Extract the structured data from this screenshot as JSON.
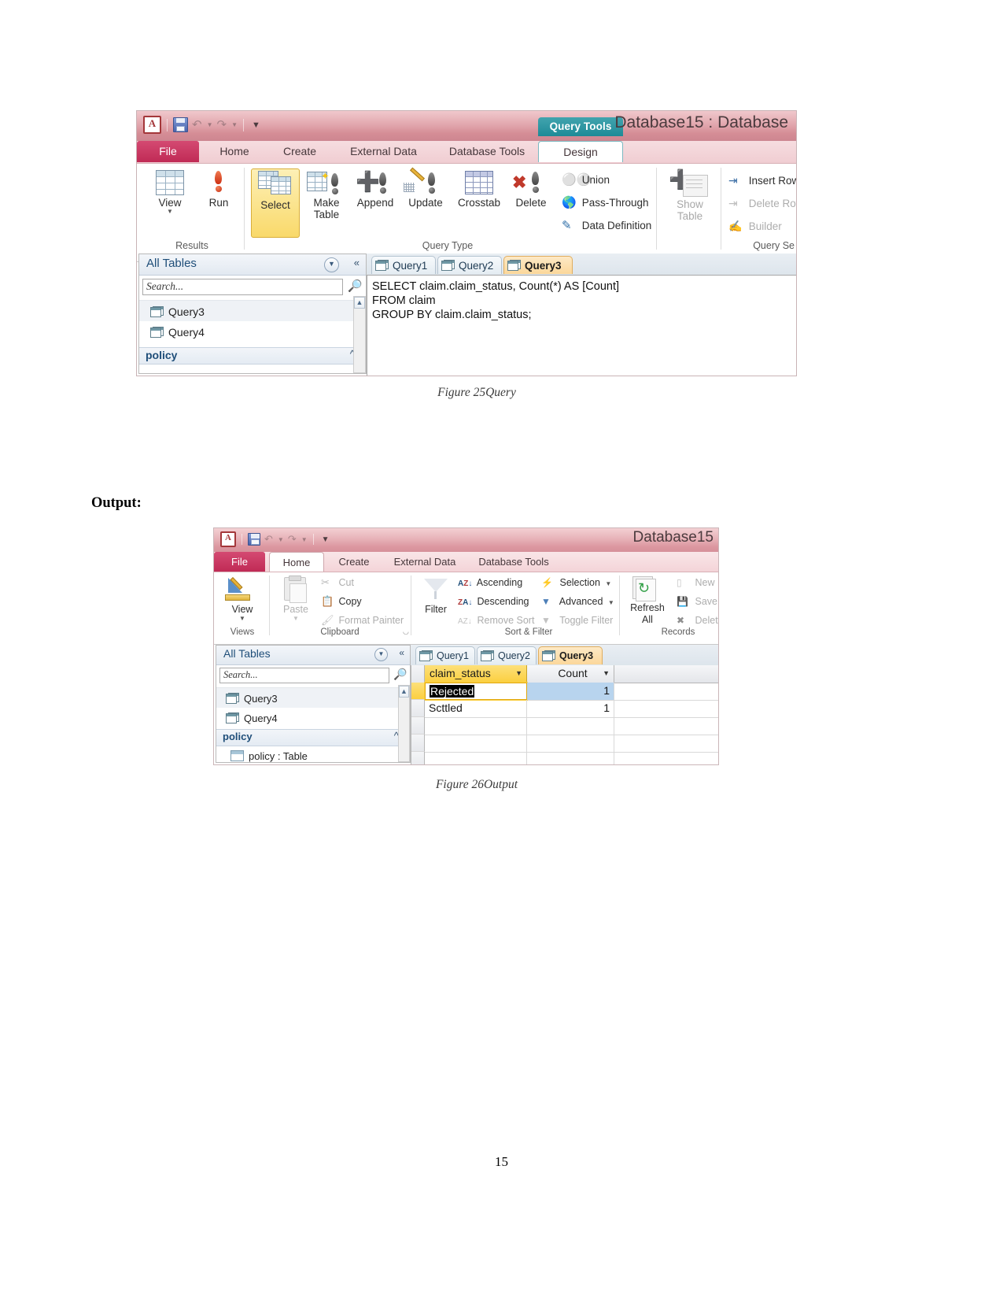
{
  "page": {
    "page_number": "15",
    "output_heading": "Output:"
  },
  "figure25": {
    "caption": "Figure 25Query",
    "window": {
      "title": "Database15 : Database",
      "quick_access": {
        "app_logo": "A",
        "save": "save-icon",
        "undo": "undo-icon",
        "redo": "redo-icon",
        "customize": "customize-qat-icon"
      },
      "contextual_tab_group": "Query Tools",
      "tabs": [
        {
          "label": "File",
          "state": "file"
        },
        {
          "label": "Home",
          "state": "normal"
        },
        {
          "label": "Create",
          "state": "normal"
        },
        {
          "label": "External Data",
          "state": "normal"
        },
        {
          "label": "Database Tools",
          "state": "normal"
        },
        {
          "label": "Design",
          "state": "active"
        }
      ],
      "ribbon": {
        "groups": [
          {
            "label": "Results"
          },
          {
            "label": "Query Type"
          },
          {
            "label": "Query Se"
          }
        ],
        "results_buttons": [
          {
            "label": "View",
            "icon": "view-grid-icon",
            "has_dropdown": true
          },
          {
            "label": "Run",
            "icon": "run-exclamation-icon"
          }
        ],
        "query_type_buttons": [
          {
            "label": "Select",
            "icon": "select-query-icon",
            "selected": true
          },
          {
            "label": "Make\nTable",
            "line1": "Make",
            "line2": "Table",
            "icon": "make-table-icon"
          },
          {
            "label": "Append",
            "icon": "append-query-icon"
          },
          {
            "label": "Update",
            "icon": "update-query-icon"
          },
          {
            "label": "Crosstab",
            "icon": "crosstab-query-icon"
          },
          {
            "label": "Delete",
            "icon": "delete-query-icon"
          }
        ],
        "query_type_small": [
          {
            "label": "Union",
            "icon": "union-icon"
          },
          {
            "label": "Pass-Through",
            "icon": "pass-through-icon"
          },
          {
            "label": "Data Definition",
            "icon": "data-definition-icon"
          }
        ],
        "setup_buttons": [
          {
            "label": "Show\nTable",
            "line1": "Show",
            "line2": "Table",
            "icon": "show-table-icon",
            "disabled": true
          }
        ],
        "setup_small": [
          {
            "label": "Insert Rows",
            "icon": "insert-rows-icon",
            "disabled": false
          },
          {
            "label": "Delete Rows",
            "icon": "delete-rows-icon",
            "disabled": true
          },
          {
            "label": "Builder",
            "icon": "builder-icon",
            "disabled": true
          }
        ]
      },
      "nav_pane": {
        "title": "All Tables",
        "menu_icon": "chevron-down-circle-icon",
        "collapse_icon": "double-chevron-left-icon",
        "search_placeholder": "Search...",
        "search_value": "",
        "search_icon": "search-icon",
        "items": [
          {
            "label": "Query3",
            "icon": "query-icon",
            "selected": true
          },
          {
            "label": "Query4",
            "icon": "query-icon",
            "selected": false
          }
        ],
        "groups": [
          {
            "label": "policy",
            "collapse_icon": "double-chevron-up-icon"
          }
        ]
      },
      "doc_tabs": [
        {
          "label": "Query1",
          "icon": "query-icon",
          "selected": false
        },
        {
          "label": "Query2",
          "icon": "query-icon",
          "selected": false
        },
        {
          "label": "Query3",
          "icon": "query-icon",
          "selected": true
        }
      ],
      "sql": "SELECT claim.claim_status, Count(*) AS [Count]\nFROM claim\nGROUP BY claim.claim_status;"
    }
  },
  "figure26": {
    "caption": "Figure 26Output",
    "window": {
      "title": "Database15",
      "quick_access": {
        "app_logo": "A",
        "save": "save-icon",
        "undo": "undo-icon",
        "redo": "redo-icon",
        "customize": "customize-qat-icon"
      },
      "tabs": [
        {
          "label": "File",
          "state": "file"
        },
        {
          "label": "Home",
          "state": "active"
        },
        {
          "label": "Create",
          "state": "normal"
        },
        {
          "label": "External Data",
          "state": "normal"
        },
        {
          "label": "Database Tools",
          "state": "normal"
        }
      ],
      "ribbon": {
        "groups": [
          {
            "label": "Views"
          },
          {
            "label": "Clipboard"
          },
          {
            "label": "Sort & Filter"
          },
          {
            "label": "Records"
          }
        ],
        "views_buttons": [
          {
            "label": "View",
            "icon": "view-design-icon",
            "has_dropdown": true
          }
        ],
        "clipboard_buttons": [
          {
            "label": "Paste",
            "icon": "paste-icon",
            "disabled": true,
            "has_dropdown": true
          }
        ],
        "clipboard_small": [
          {
            "label": "Cut",
            "icon": "cut-scissors-icon",
            "disabled": true
          },
          {
            "label": "Copy",
            "icon": "copy-icon",
            "disabled": false
          },
          {
            "label": "Format Painter",
            "icon": "format-painter-icon",
            "disabled": true
          }
        ],
        "clipboard_launcher": "dialog-launcher-icon",
        "sort_filter_buttons": [
          {
            "label": "Filter",
            "icon": "filter-funnel-icon"
          }
        ],
        "sort_filter_small": [
          {
            "label": "Ascending",
            "icon": "sort-ascending-icon",
            "disabled": false
          },
          {
            "label": "Descending",
            "icon": "sort-descending-icon",
            "disabled": false
          },
          {
            "label": "Remove Sort",
            "icon": "remove-sort-icon",
            "disabled": true
          },
          {
            "label": "Selection",
            "icon": "selection-icon",
            "disabled": false,
            "has_dropdown": true
          },
          {
            "label": "Advanced",
            "icon": "advanced-filter-icon",
            "disabled": false,
            "has_dropdown": true
          },
          {
            "label": "Toggle Filter",
            "icon": "toggle-filter-icon",
            "disabled": true
          }
        ],
        "records_buttons": [
          {
            "label": "Refresh\nAll",
            "line1": "Refresh",
            "line2": "All",
            "icon": "refresh-all-icon",
            "has_dropdown": true
          }
        ],
        "records_small": [
          {
            "label": "New",
            "icon": "new-record-icon",
            "disabled": true
          },
          {
            "label": "Save",
            "icon": "save-record-icon",
            "disabled": true
          },
          {
            "label": "Delete",
            "icon": "delete-record-icon",
            "disabled": true,
            "has_dropdown": true
          }
        ]
      },
      "nav_pane": {
        "title": "All Tables",
        "menu_icon": "chevron-down-circle-icon",
        "collapse_icon": "double-chevron-left-icon",
        "search_placeholder": "Search...",
        "search_value": "",
        "search_icon": "search-icon",
        "items": [
          {
            "label": "Query3",
            "icon": "query-icon",
            "selected": true
          },
          {
            "label": "Query4",
            "icon": "query-icon",
            "selected": false
          }
        ],
        "groups": [
          {
            "label": "policy",
            "collapse_icon": "double-chevron-up-icon"
          }
        ],
        "group_items": [
          {
            "label": "policy : Table",
            "icon": "table-icon"
          }
        ]
      },
      "doc_tabs": [
        {
          "label": "Query1",
          "icon": "query-icon",
          "selected": false
        },
        {
          "label": "Query2",
          "icon": "query-icon",
          "selected": false
        },
        {
          "label": "Query3",
          "icon": "query-icon",
          "selected": true
        }
      ],
      "datasheet": {
        "columns": [
          {
            "label": "claim_status",
            "highlighted": true,
            "dropdown_icon": "chevron-down-icon"
          },
          {
            "label": "Count",
            "highlighted": false,
            "dropdown_icon": "chevron-down-icon"
          }
        ],
        "rows": [
          {
            "claim_status": "Rejected",
            "count": "1",
            "current": true,
            "editing": true
          },
          {
            "claim_status": "Scttled",
            "count": "1",
            "current": false,
            "editing": false
          }
        ]
      }
    }
  },
  "colors": {
    "ribbon_pink": "#e2a7ae",
    "file_tab": "#c02a55",
    "context_teal": "#1e8a97",
    "selected_tab_orange": "#fbd79a",
    "highlight_yellow": "#fbcf3f",
    "selection_blue": "#b8d4ee",
    "nav_title_blue": "#1f4e79"
  }
}
